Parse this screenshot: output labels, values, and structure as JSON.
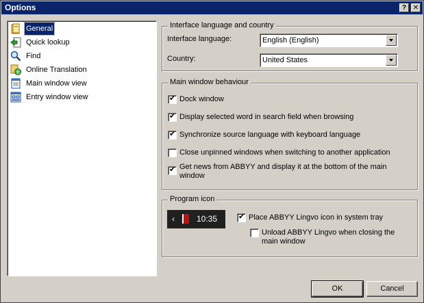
{
  "window": {
    "title": "Options",
    "help_button": "?",
    "close_button": "✕"
  },
  "sidebar": {
    "items": [
      {
        "label": "General",
        "icon": "general-icon"
      },
      {
        "label": "Quick lookup",
        "icon": "quick-lookup-icon"
      },
      {
        "label": "Find",
        "icon": "find-icon"
      },
      {
        "label": "Online Translation",
        "icon": "online-translation-icon"
      },
      {
        "label": "Main window view",
        "icon": "main-window-view-icon"
      },
      {
        "label": "Entry window view",
        "icon": "entry-window-view-icon"
      }
    ]
  },
  "interface_group": {
    "title": "Interface language and country",
    "language_label": "Interface language:",
    "language_value": "English (English)",
    "country_label": "Country:",
    "country_value": "United States"
  },
  "main_window_group": {
    "title": "Main window behaviour",
    "options": [
      {
        "label": "Dock window",
        "checked": true
      },
      {
        "label": "Display selected word in search field when browsing",
        "checked": true
      },
      {
        "label": "Synchronize source language with keyboard language",
        "checked": true
      },
      {
        "label": "Close unpinned windows when switching to another application",
        "checked": false
      },
      {
        "label": "Get news from ABBYY and display it at the bottom of the main window",
        "checked": true
      }
    ]
  },
  "program_icon_group": {
    "title": "Program icon",
    "tray_time": "10:35",
    "place_icon_label": "Place ABBYY Lingvo icon in system tray",
    "place_icon_checked": true,
    "unload_label": "Unload ABBYY Lingvo when closing the main window",
    "unload_checked": false
  },
  "buttons": {
    "ok": "OK",
    "cancel": "Cancel"
  }
}
